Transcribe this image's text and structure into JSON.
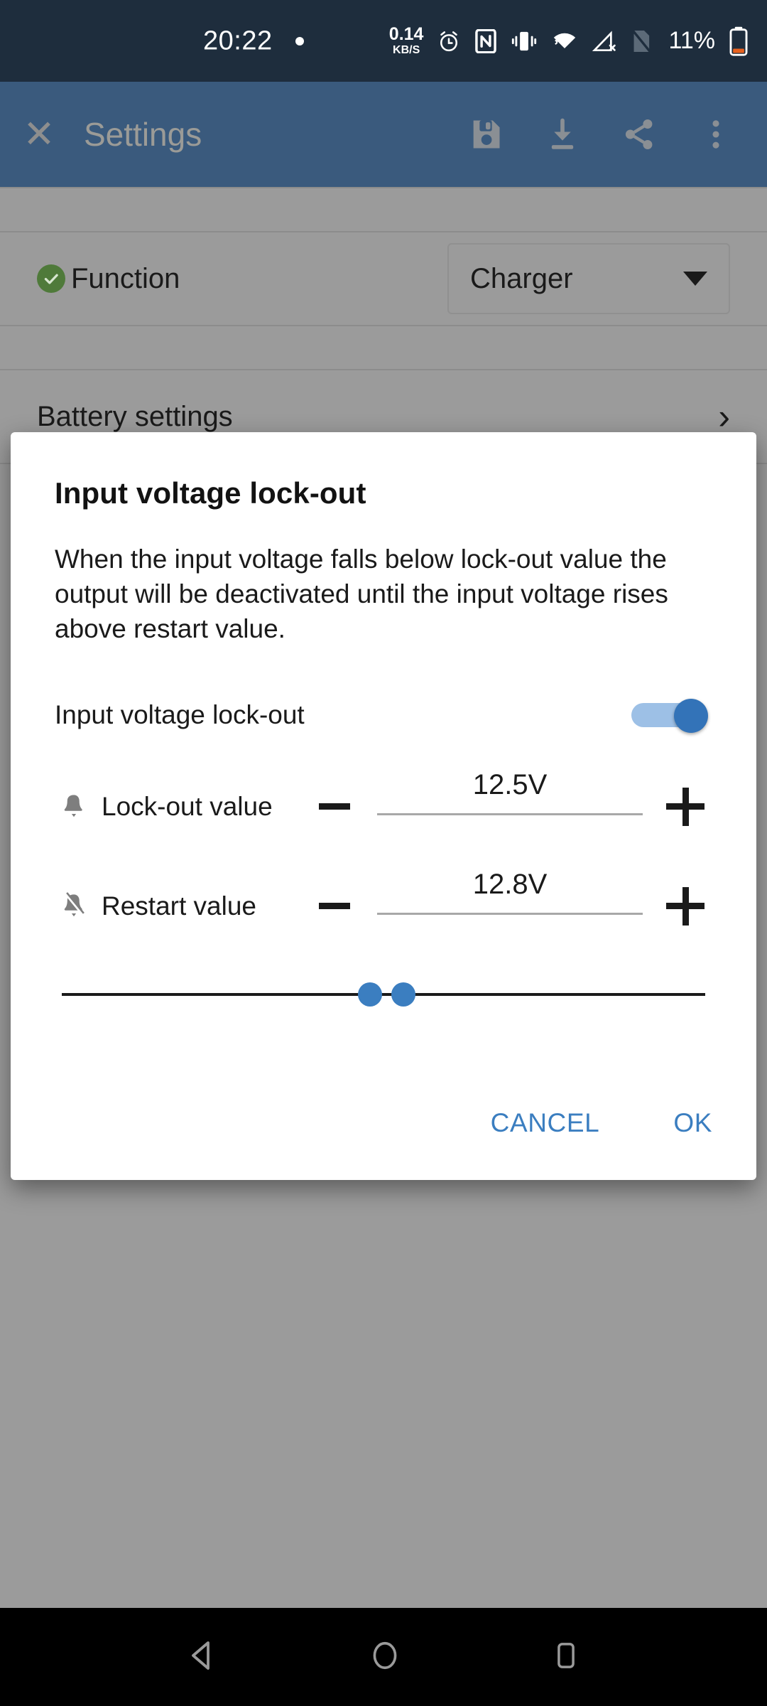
{
  "status_bar": {
    "time": "20:22",
    "dot_icon": "notification-dot-icon",
    "data_rate_value": "0.14",
    "data_rate_unit": "KB/S",
    "icons": [
      "alarm-icon",
      "nfc-icon",
      "vibrate-icon",
      "wifi-icon",
      "no-signal-icon",
      "sim-card-icon"
    ],
    "battery_percent": "11%",
    "battery_icon": "battery-low-icon",
    "background_color": "#1e2d3d"
  },
  "app_bar": {
    "close_label": "✕",
    "title": "Settings",
    "background_color": "#3a5a7d",
    "actions": [
      {
        "name": "save-icon",
        "label": "Save"
      },
      {
        "name": "download-icon",
        "label": "Download"
      },
      {
        "name": "share-icon",
        "label": "Share"
      },
      {
        "name": "overflow-menu-icon",
        "label": "More options"
      }
    ]
  },
  "settings_list": {
    "function_row": {
      "label": "Function",
      "status_icon": "check-circle-icon",
      "status_color": "#4f7a3a",
      "dropdown_value": "Charger"
    },
    "battery_row": {
      "label": "Battery settings",
      "chevron": "›"
    }
  },
  "dialog": {
    "title": "Input voltage lock-out",
    "body": "When the input voltage falls below lock-out value the output will be deactivated until the input voltage rises above restart value.",
    "toggle": {
      "label": "Input voltage lock-out",
      "state": "on",
      "accent_color": "#3373b8"
    },
    "steppers": [
      {
        "icon": "bell-icon",
        "label": "Lock-out value",
        "minus_label": "−",
        "value": "12.5V",
        "plus_label": "+"
      },
      {
        "icon": "bell-muted-icon",
        "label": "Restart value",
        "minus_label": "−",
        "value": "12.8V",
        "plus_label": "+"
      }
    ],
    "range_slider": {
      "low_thumb_percent": 48,
      "high_thumb_percent": 53,
      "thumb_color": "#3b7ec0"
    },
    "cancel_label": "CANCEL",
    "ok_label": "OK",
    "action_color": "#3b7ec0"
  },
  "nav_bar": {
    "back_icon": "back-triangle-icon",
    "home_icon": "home-circle-icon",
    "recents_icon": "recents-square-icon"
  }
}
